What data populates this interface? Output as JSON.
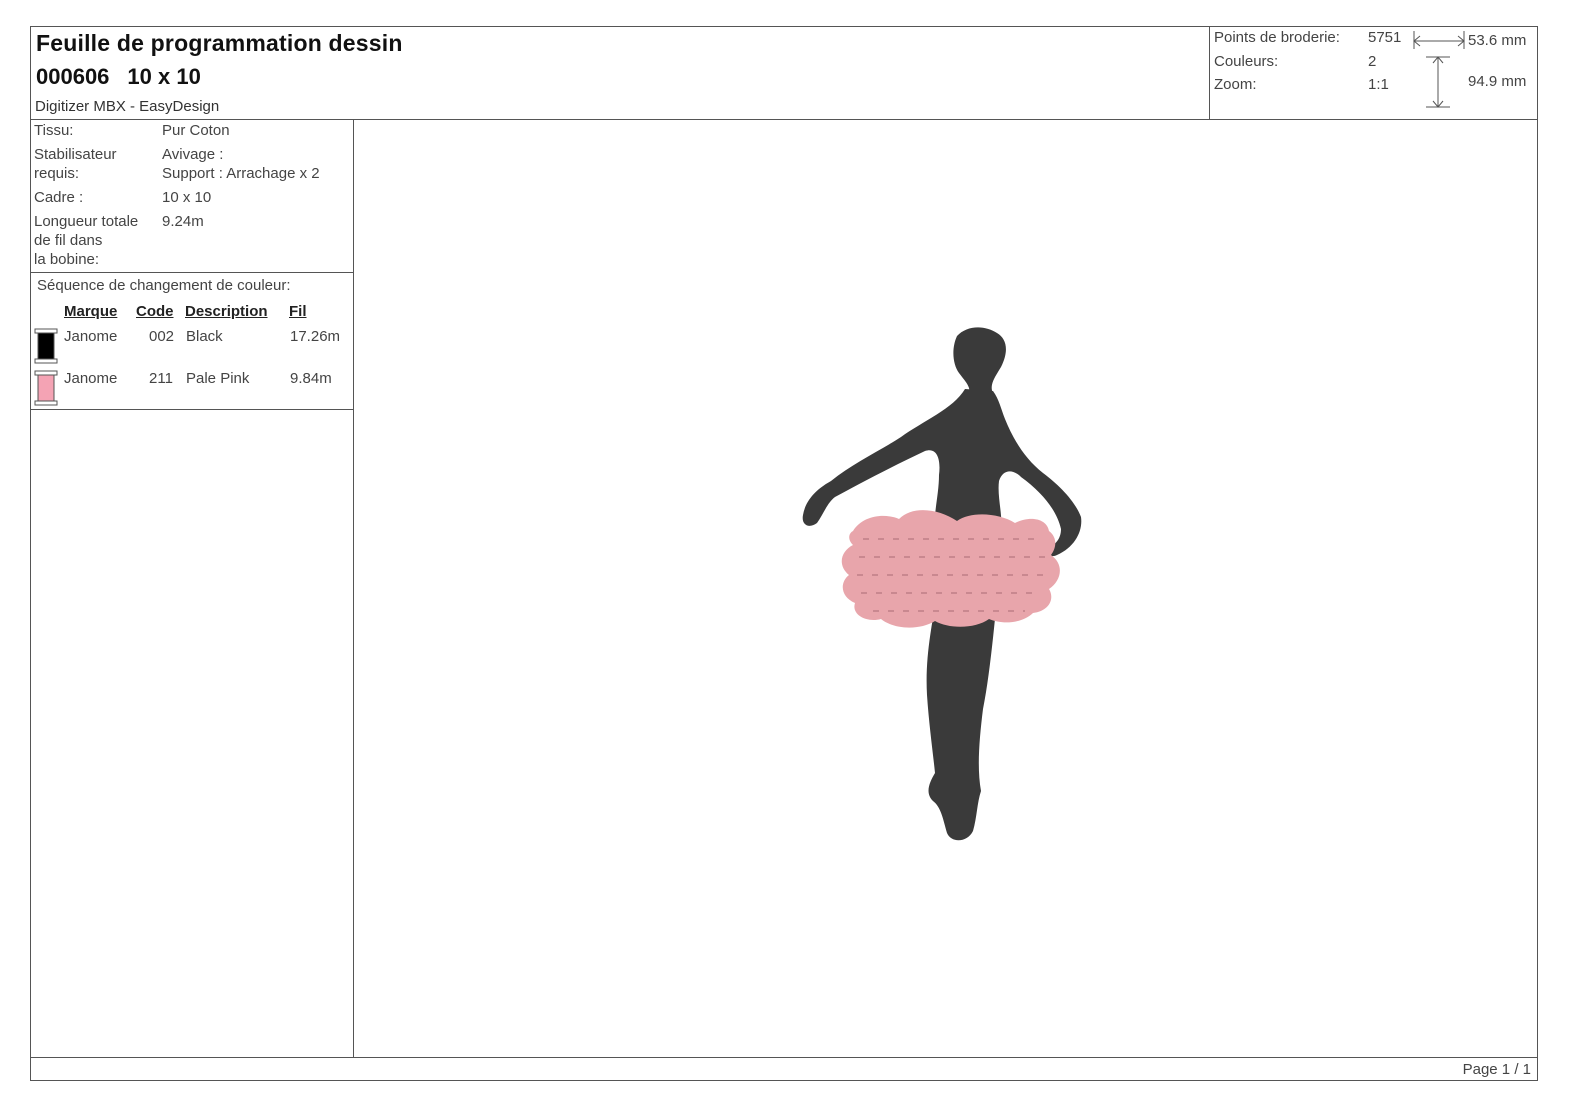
{
  "header": {
    "title": "Feuille de programmation dessin",
    "design_number": "000606",
    "hoop_size": "10 x 10",
    "software": "Digitizer MBX - EasyDesign"
  },
  "stats": {
    "stitches_label": "Points de broderie:",
    "stitches_value": "5751",
    "colors_label": "Couleurs:",
    "colors_value": "2",
    "zoom_label": "Zoom:",
    "zoom_value": "1:1",
    "width": "53.6 mm",
    "height": "94.9 mm"
  },
  "info": {
    "fabric_label": "Tissu:",
    "fabric_value": "Pur Coton",
    "stabilizer_label_1": "Stabilisateur",
    "stabilizer_label_2": "requis:",
    "stabilizer_value_1": "Avivage :",
    "stabilizer_value_2": "Support : Arrachage x 2",
    "frame_label": "Cadre :",
    "frame_value": "10 x 10",
    "thread_label_1": "Longueur totale",
    "thread_label_2": "de fil dans",
    "thread_label_3": "la bobine:",
    "thread_value": "9.24m"
  },
  "sequence": {
    "title": "Séquence de changement de couleur:",
    "headers": {
      "brand": "Marque",
      "code": "Code",
      "description": "Description",
      "thread": "Fil"
    },
    "rows": [
      {
        "brand": "Janome",
        "code": "002",
        "description": "Black",
        "thread": "17.26m",
        "color": "#000000"
      },
      {
        "brand": "Janome",
        "code": "211",
        "description": "Pale Pink",
        "thread": "9.84m",
        "color": "#f4a3b4"
      }
    ]
  },
  "design_colors": {
    "body": "#3a3a3a",
    "tutu": "#e8a5ab",
    "tutu_shadow": "#c98890"
  },
  "footer": {
    "page": "Page 1 / 1"
  }
}
